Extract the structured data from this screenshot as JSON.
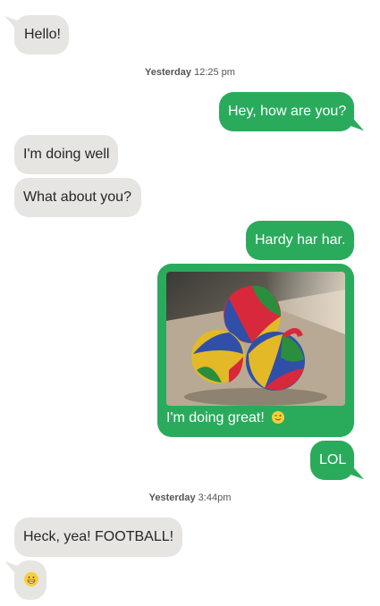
{
  "messages": {
    "m1": "Hello!",
    "m2": "Hey, how are you?",
    "m3": "I'm doing well",
    "m4": "What about you?",
    "m5": "Hardy har har.",
    "m6_caption": "I'm doing great!",
    "m7": "LOL",
    "m8": "Heck, yea! FOOTBALL!"
  },
  "timestamps": {
    "t1_day": "Yesterday",
    "t1_time": "12:25 pm",
    "t2_day": "Yesterday",
    "t2_time": "3:44pm"
  },
  "icons": {
    "wink": "winking-face-icon",
    "grin": "grinning-face-icon"
  },
  "colors": {
    "incoming_bubble": "#e6e5e2",
    "outgoing_bubble": "#2aab5c",
    "emoji_yellow": "#f7cf3a"
  }
}
